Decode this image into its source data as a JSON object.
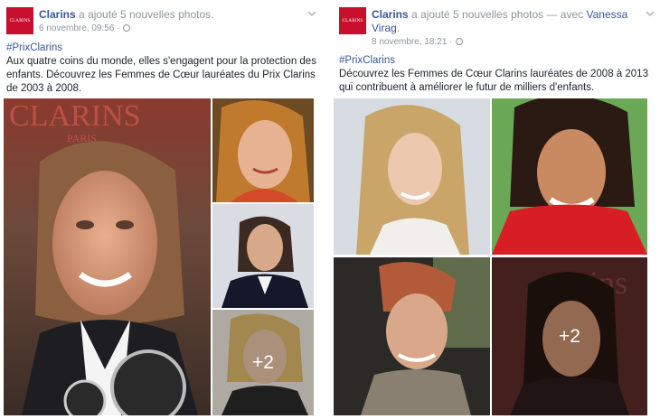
{
  "posts": [
    {
      "page_name": "Clarins",
      "logo_text": "CLARINS",
      "action": " a ajouté 5 nouvelles photos.",
      "with_text": "",
      "tagged": "",
      "date": "6 novembre, 09:56 ·",
      "hashtag": "#PrixClarins",
      "body": "Aux quatre coins du monde, elles s'engagent pour la protection des enfants. Découvrez les Femmes de Cœur lauréates du Prix Clarins de 2003 à 2008.",
      "more_count": "+2"
    },
    {
      "page_name": "Clarins",
      "logo_text": "CLARINS",
      "action": " a ajouté 5 nouvelles photos",
      "with_text": " — avec ",
      "tagged": "Vanessa Virag",
      "date": "8 novembre, 18:21 ·",
      "hashtag": "#PrixClarins",
      "body": "Découvrez les Femmes de Cœur Clarins lauréates de 2008 à 2013 qui contribuent à améliorer le futur de milliers d'enfants.",
      "more_count": "+2"
    }
  ],
  "colors": {
    "link": "#365899",
    "meta": "#90949c",
    "brand_red": "#c8102e"
  },
  "icons": [
    "clarins-logo",
    "globe-icon",
    "chevron-down-icon"
  ]
}
